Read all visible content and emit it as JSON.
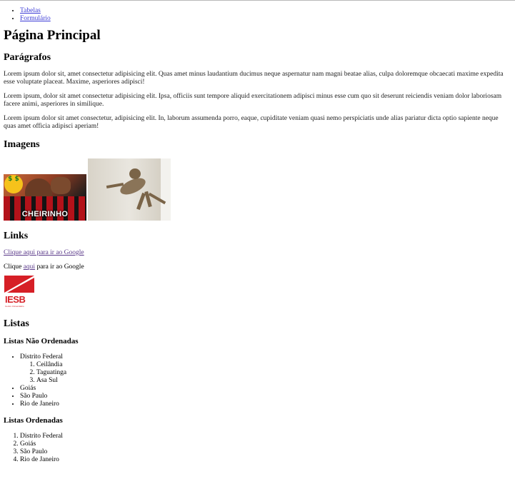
{
  "nav": {
    "items": [
      {
        "label": "Tabelas"
      },
      {
        "label": "Formulário"
      }
    ]
  },
  "main": {
    "title": "Página Principal",
    "paragraphs_heading": "Parágrafos",
    "paragraphs": [
      "Lorem ipsum dolor sit, amet consectetur adipisicing elit. Quas amet minus laudantium ducimus neque aspernatur nam magni beatae alias, culpa doloremque obcaecati maxime expedita esse voluptate placeat. Maxime, asperiores adipisci!",
      "Lorem ipsum, dolor sit amet consectetur adipisicing elit. Ipsa, officiis sunt tempore aliquid exercitationem adipisci minus esse cum quo sit deserunt reiciendis veniam dolor laboriosam facere animi, asperiores in similique.",
      "Lorem ipsum dolor sit amet consectetur, adipisicing elit. In, laborum assumenda porro, eaque, cupiditate veniam quasi nemo perspiciatis unde alias pariatur dicta optio sapiente neque quas amet officia adipisci aperiam!"
    ],
    "images_heading": "Imagens",
    "images": [
      {
        "caption": "CHEIRINHO",
        "emoji_text": "$ $"
      }
    ],
    "links_heading": "Links",
    "link1_text": "Clique aqui para ir ao Google",
    "link2_before": "Clique ",
    "link2_anchor": "aqui",
    "link2_after": " para ir ao Google",
    "logo": {
      "text": "IESB",
      "subtext": "Centro Universitário",
      "color": "#d61f26"
    },
    "lists_heading": "Listas",
    "unordered_heading": "Listas Não Ordenadas",
    "unordered": {
      "first": "Distrito Federal",
      "nested": [
        "Ceilândia",
        "Taguatinga",
        "Asa Sul"
      ],
      "rest": [
        "Goiás",
        "São Paulo",
        "Rio de Janeiro"
      ]
    },
    "ordered_heading": "Listas Ordenadas",
    "ordered": [
      "Distrito Federal",
      "Goiás",
      "São Paulo",
      "Rio de Janeiro"
    ]
  }
}
